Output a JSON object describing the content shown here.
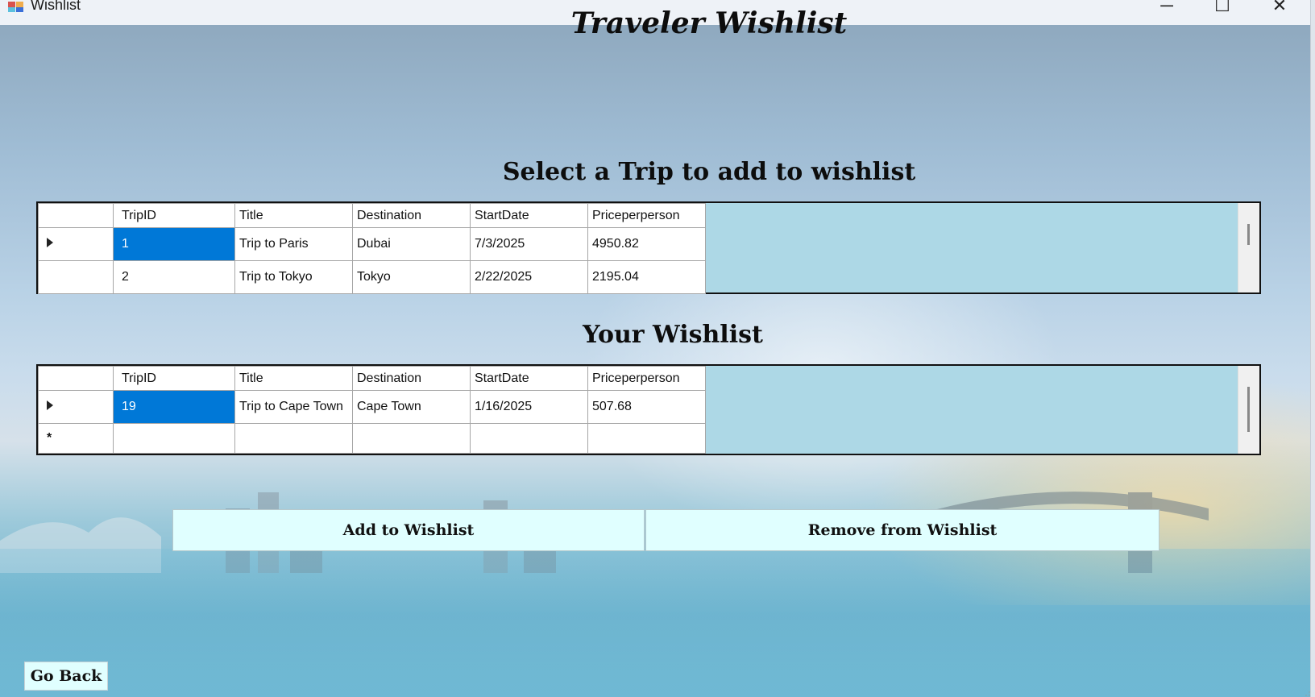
{
  "window": {
    "title": "Wishlist",
    "minimize_glyph": "─",
    "maximize_glyph": "☐",
    "close_glyph": "✕"
  },
  "headings": {
    "title": "Traveler Wishlist",
    "select": "Select a Trip to add to wishlist",
    "wishlist": "Your Wishlist"
  },
  "columns": [
    "TripID",
    "Title",
    "Destination",
    "StartDate",
    "Priceperperson"
  ],
  "trips": [
    {
      "id": "1",
      "title": "Trip to Paris",
      "destination": "Dubai",
      "start": "7/3/2025",
      "price": "4950.82"
    },
    {
      "id": "2",
      "title": "Trip to Tokyo",
      "destination": "Tokyo",
      "start": "2/22/2025",
      "price": "2195.04"
    }
  ],
  "wishlist": [
    {
      "id": "19",
      "title": "Trip to Cape Town",
      "destination": "Cape Town",
      "start": "1/16/2025",
      "price": "507.68"
    }
  ],
  "new_row_glyph": "*",
  "buttons": {
    "add": "Add to Wishlist",
    "remove": "Remove from Wishlist",
    "back": "Go Back"
  },
  "colors": {
    "grid_background": "#add8e6",
    "selection": "#0078d7",
    "button_background": "#e0ffff"
  }
}
